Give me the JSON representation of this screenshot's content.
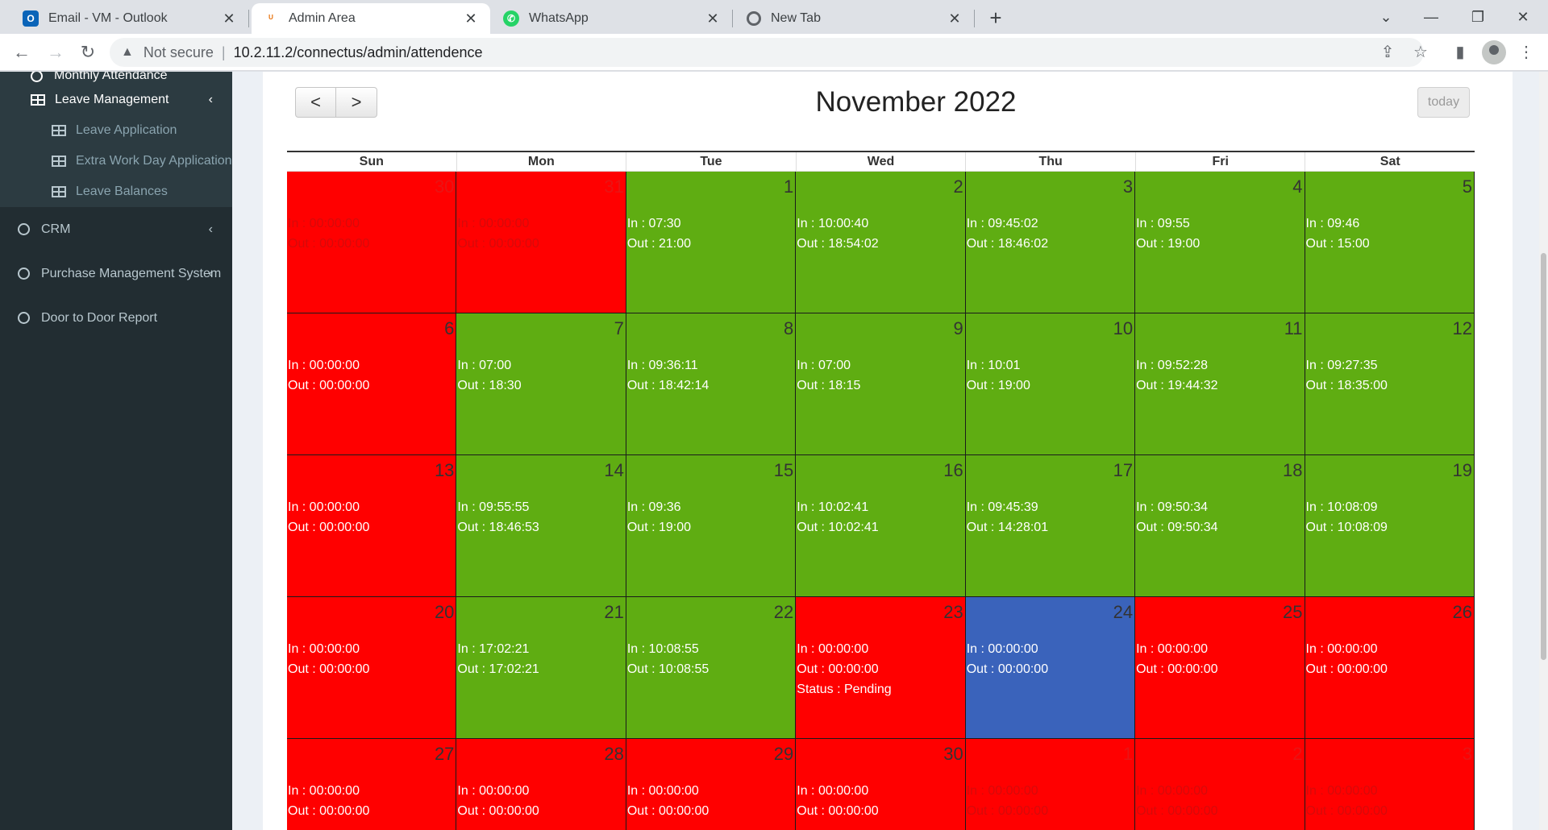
{
  "browser": {
    "tabs": [
      {
        "title": "Email - VM - Outlook",
        "active": false,
        "icon": "outlook-icon"
      },
      {
        "title": "Admin Area",
        "active": true,
        "icon": "site-icon"
      },
      {
        "title": "WhatsApp",
        "active": false,
        "icon": "whatsapp-icon"
      },
      {
        "title": "New Tab",
        "active": false,
        "icon": "chrome-icon"
      }
    ],
    "new_tab_glyph": "+",
    "security_label": "Not secure",
    "url": "10.2.11.2/connectus/admin/attendence"
  },
  "sidebar": {
    "top_item": "Monthly Attendance",
    "group": {
      "label": "Leave Management"
    },
    "sub_items": [
      "Leave Application",
      "Extra Work Day Application",
      "Leave Balances"
    ],
    "items": [
      {
        "label": "CRM",
        "has_chevron": true
      },
      {
        "label": "Purchase Management System",
        "has_chevron": true
      },
      {
        "label": "Door to Door Report",
        "has_chevron": false
      }
    ]
  },
  "calendar": {
    "title": "November 2022",
    "today_label": "today",
    "prev_glyph": "<",
    "next_glyph": ">",
    "colors": {
      "absent": "#ff0000",
      "present": "#5fad12",
      "today": "#3a63bb"
    },
    "weekdays": [
      "Sun",
      "Mon",
      "Tue",
      "Wed",
      "Thu",
      "Fri",
      "Sat"
    ],
    "weeks": [
      [
        {
          "day": "30",
          "color": "red",
          "other": true,
          "in": "In : 00:00:00",
          "out": "Out : 00:00:00"
        },
        {
          "day": "31",
          "color": "red",
          "other": true,
          "in": "In : 00:00:00",
          "out": "Out : 00:00:00"
        },
        {
          "day": "1",
          "color": "green",
          "in": "In : 07:30",
          "out": "Out : 21:00"
        },
        {
          "day": "2",
          "color": "green",
          "in": "In : 10:00:40",
          "out": "Out : 18:54:02"
        },
        {
          "day": "3",
          "color": "green",
          "in": "In : 09:45:02",
          "out": "Out : 18:46:02"
        },
        {
          "day": "4",
          "color": "green",
          "in": "In : 09:55",
          "out": "Out : 19:00"
        },
        {
          "day": "5",
          "color": "green",
          "in": "In : 09:46",
          "out": "Out : 15:00"
        }
      ],
      [
        {
          "day": "6",
          "color": "red",
          "in": "In : 00:00:00",
          "out": "Out : 00:00:00"
        },
        {
          "day": "7",
          "color": "green",
          "in": "In : 07:00",
          "out": "Out : 18:30"
        },
        {
          "day": "8",
          "color": "green",
          "in": "In : 09:36:11",
          "out": "Out : 18:42:14"
        },
        {
          "day": "9",
          "color": "green",
          "in": "In : 07:00",
          "out": "Out : 18:15"
        },
        {
          "day": "10",
          "color": "green",
          "in": "In : 10:01",
          "out": "Out : 19:00"
        },
        {
          "day": "11",
          "color": "green",
          "in": "In : 09:52:28",
          "out": "Out : 19:44:32"
        },
        {
          "day": "12",
          "color": "green",
          "in": "In : 09:27:35",
          "out": "Out : 18:35:00"
        }
      ],
      [
        {
          "day": "13",
          "color": "red",
          "in": "In : 00:00:00",
          "out": "Out : 00:00:00"
        },
        {
          "day": "14",
          "color": "green",
          "in": "In : 09:55:55",
          "out": "Out : 18:46:53"
        },
        {
          "day": "15",
          "color": "green",
          "in": "In : 09:36",
          "out": "Out : 19:00"
        },
        {
          "day": "16",
          "color": "green",
          "in": "In : 10:02:41",
          "out": "Out : 10:02:41"
        },
        {
          "day": "17",
          "color": "green",
          "in": "In : 09:45:39",
          "out": "Out : 14:28:01"
        },
        {
          "day": "18",
          "color": "green",
          "in": "In : 09:50:34",
          "out": "Out : 09:50:34"
        },
        {
          "day": "19",
          "color": "green",
          "in": "In : 10:08:09",
          "out": "Out : 10:08:09"
        }
      ],
      [
        {
          "day": "20",
          "color": "red",
          "in": "In : 00:00:00",
          "out": "Out : 00:00:00"
        },
        {
          "day": "21",
          "color": "green",
          "in": "In : 17:02:21",
          "out": "Out : 17:02:21"
        },
        {
          "day": "22",
          "color": "green",
          "in": "In : 10:08:55",
          "out": "Out : 10:08:55"
        },
        {
          "day": "23",
          "color": "red",
          "in": "In : 00:00:00",
          "out": "Out : 00:00:00",
          "status": "Status : Pending"
        },
        {
          "day": "24",
          "color": "blue",
          "in": "In : 00:00:00",
          "out": "Out : 00:00:00"
        },
        {
          "day": "25",
          "color": "red",
          "in": "In : 00:00:00",
          "out": "Out : 00:00:00"
        },
        {
          "day": "26",
          "color": "red",
          "in": "In : 00:00:00",
          "out": "Out : 00:00:00"
        }
      ],
      [
        {
          "day": "27",
          "color": "red",
          "in": "In : 00:00:00",
          "out": "Out : 00:00:00"
        },
        {
          "day": "28",
          "color": "red",
          "in": "In : 00:00:00",
          "out": "Out : 00:00:00"
        },
        {
          "day": "29",
          "color": "red",
          "in": "In : 00:00:00",
          "out": "Out : 00:00:00"
        },
        {
          "day": "30",
          "color": "red",
          "in": "In : 00:00:00",
          "out": "Out : 00:00:00"
        },
        {
          "day": "1",
          "color": "red",
          "other": true,
          "in": "In : 00:00:00",
          "out": "Out : 00:00:00"
        },
        {
          "day": "2",
          "color": "red",
          "other": true,
          "in": "In : 00:00:00",
          "out": "Out : 00:00:00"
        },
        {
          "day": "3",
          "color": "red",
          "other": true,
          "in": "In : 00:00:00",
          "out": "Out : 00:00:00"
        }
      ]
    ]
  }
}
